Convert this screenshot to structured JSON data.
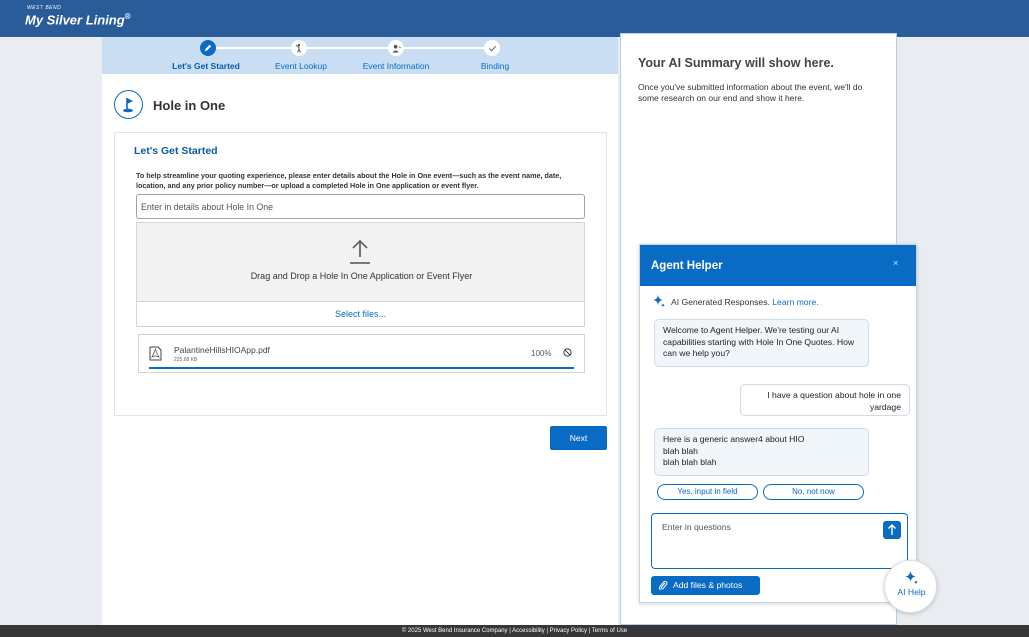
{
  "header": {
    "brand_small": "WEST BEND",
    "brand": "My Silver Lining",
    "brand_mark": "®"
  },
  "stepper": {
    "steps": [
      {
        "label": "Let's Get Started",
        "icon": "pencil-icon",
        "active": true
      },
      {
        "label": "Event Lookup",
        "icon": "golfer-icon",
        "active": false
      },
      {
        "label": "Event Information",
        "icon": "person-icon",
        "active": false
      },
      {
        "label": "Binding",
        "icon": "check-icon",
        "active": false
      }
    ]
  },
  "page": {
    "title": "Hole in One",
    "icon": "golf-flag-icon"
  },
  "card": {
    "title": "Let's Get Started",
    "description": "To help streamline your quoting experience, please enter details about the Hole in One event—such as the event name, date, location, and any prior policy number—or upload a completed Hole in One application or event flyer.",
    "input_placeholder": "Enter in details about Hole In One",
    "dropzone_text": "Drag and Drop a Hole In One Application or Event Flyer",
    "select_files": "Select files...",
    "file": {
      "name": "PalantineHillsHIOApp.pdf",
      "size": "225.68 KB",
      "progress": "100%",
      "progress_fraction": 1.0
    }
  },
  "next_button": "Next",
  "summary": {
    "title": "Your AI Summary will show here.",
    "text": "Once you've submitted information about the event, we'll do some research on our end and show it here."
  },
  "agent": {
    "title": "Agent Helper",
    "close": "×",
    "ai_generated": "AI Generated Responses.",
    "learn_more": "Learn more.",
    "messages": [
      {
        "from": "bot",
        "text": "Welcome to Agent Helper. We're testing our AI capabilities starting with Hole In One Quotes. How can we help you?"
      },
      {
        "from": "user",
        "text": "I have a question about hole in one yardage"
      },
      {
        "from": "bot",
        "lines": [
          "Here is a generic answer4 about HIO",
          "blah blah",
          "blah blah blah"
        ]
      }
    ],
    "yes_button": "Yes, input in field",
    "no_button": "No, not now",
    "question_placeholder": "Enter in questions",
    "add_files": "Add files & photos"
  },
  "ai_help": {
    "label": "AI Help"
  },
  "footer": {
    "text": "© 2025 West Bend Insurance Company | Accessibility | Privacy Policy | Terms of Use"
  },
  "colors": {
    "brand_blue": "#2a5c9a",
    "accent": "#0a6bc4",
    "stepper_bg": "#c9def2",
    "footer_bg": "#373737"
  }
}
